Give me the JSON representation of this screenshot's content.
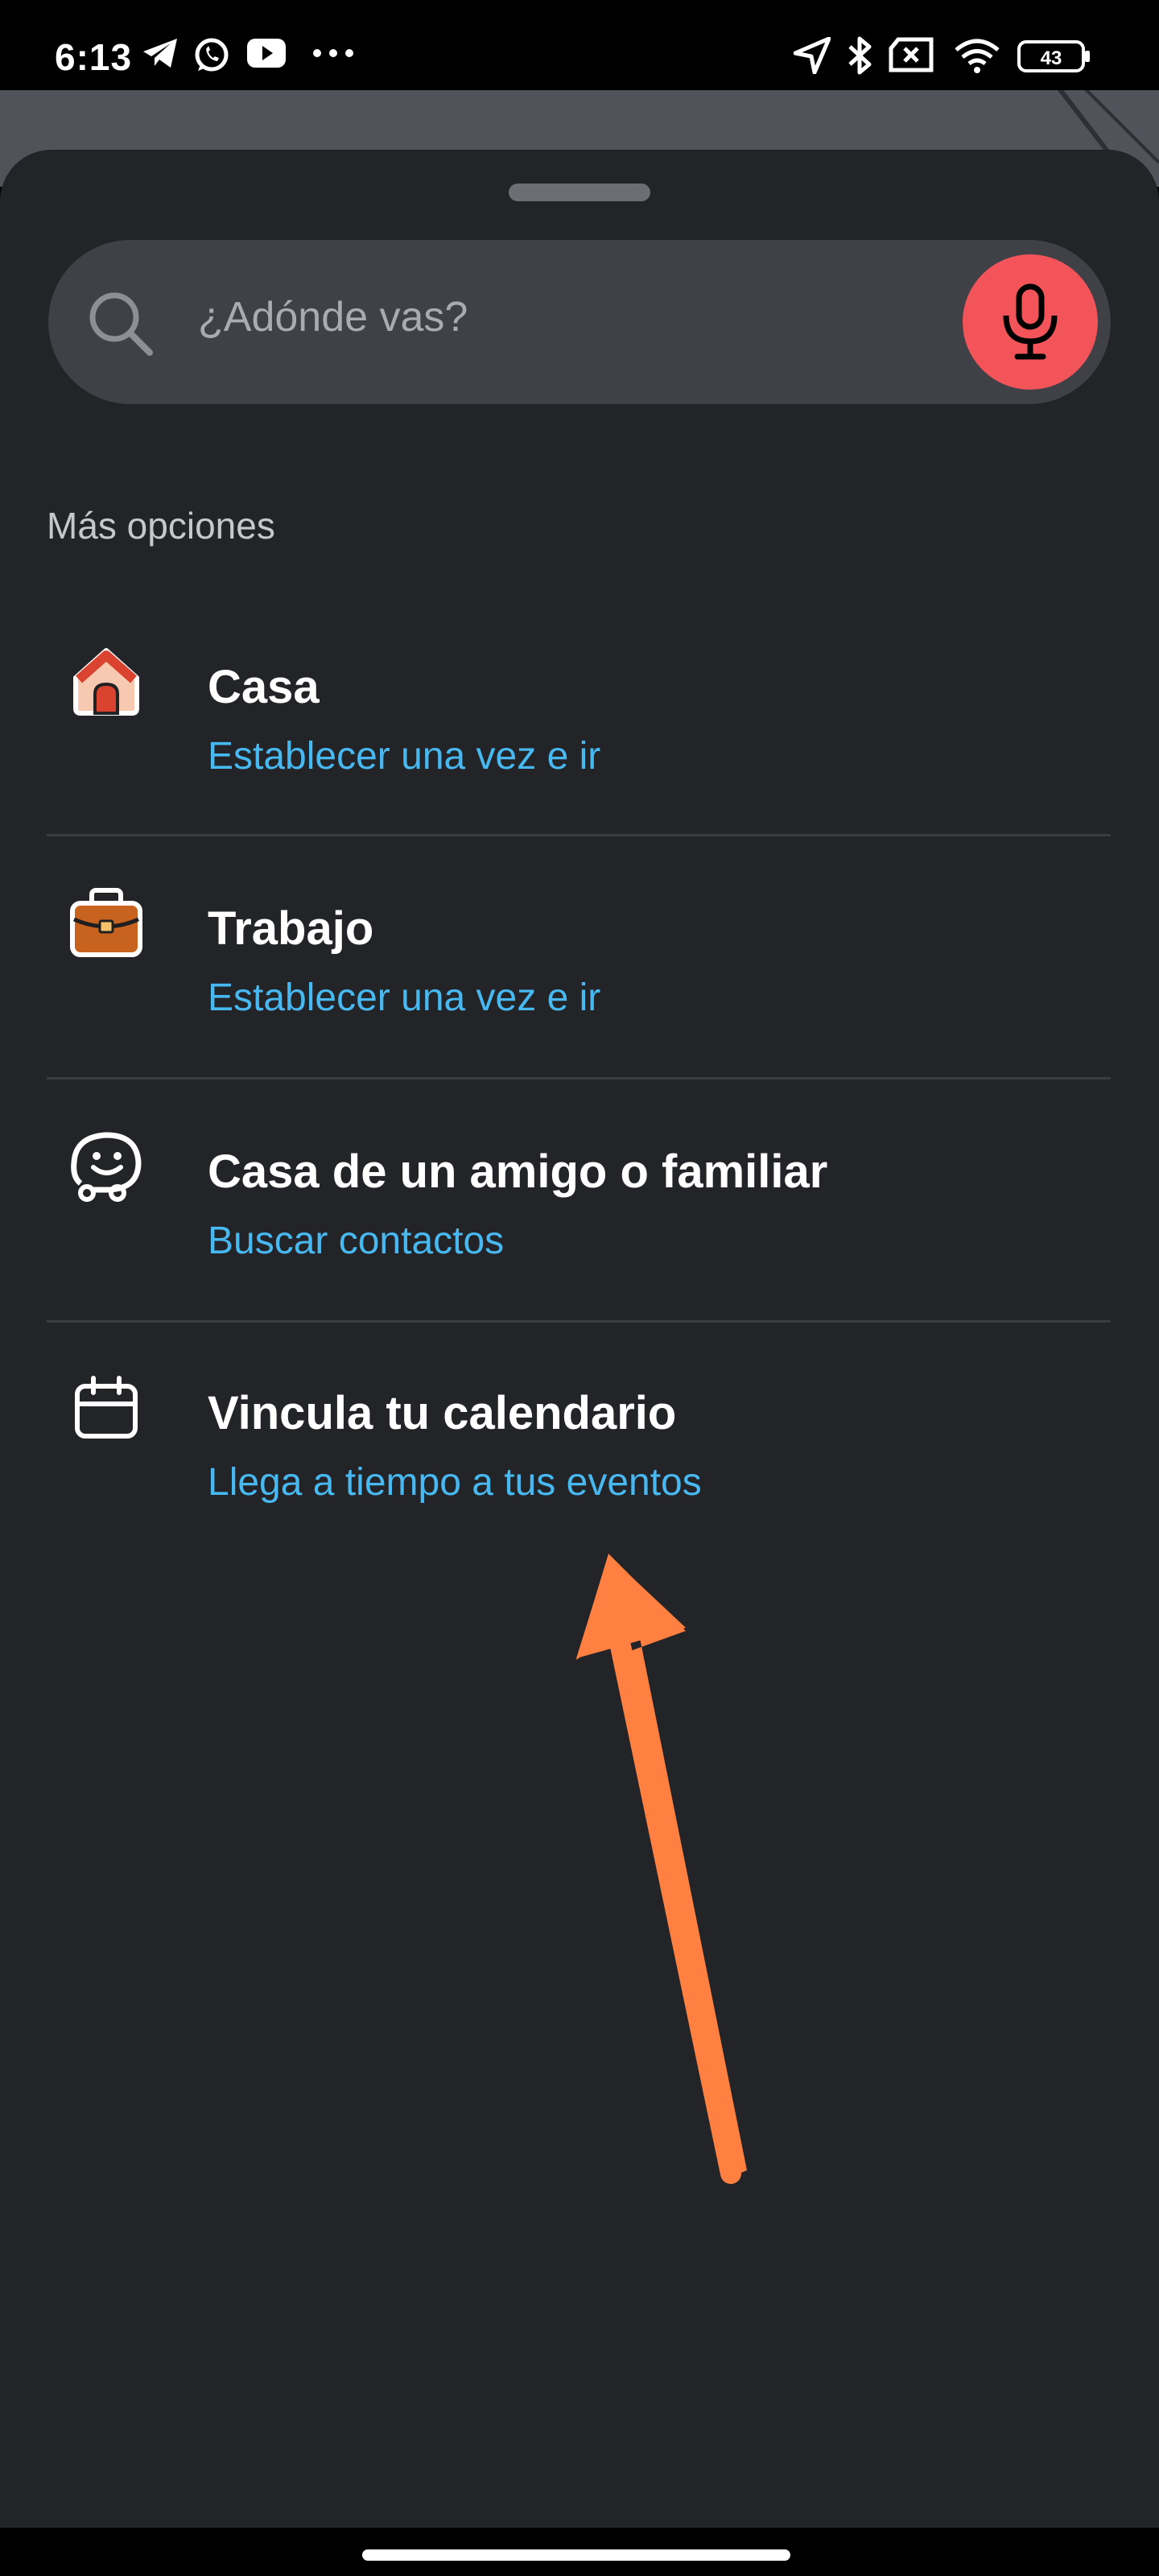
{
  "status_bar": {
    "time": "6:13",
    "left_icons": [
      "telegram-icon",
      "whatsapp-icon",
      "youtube-icon",
      "more-dots-icon"
    ],
    "right_icons": [
      "location-arrow-icon",
      "bluetooth-icon",
      "no-sim-icon",
      "wifi-icon",
      "battery-icon"
    ],
    "battery_level": "43"
  },
  "search": {
    "placeholder": "¿Adónde vas?",
    "mic_color": "#f2545a"
  },
  "section": {
    "title": "Más opciones"
  },
  "options": [
    {
      "icon": "home-icon",
      "title": "Casa",
      "subtitle": "Establecer una vez e ir"
    },
    {
      "icon": "briefcase-icon",
      "title": "Trabajo",
      "subtitle": "Establecer una vez e ir"
    },
    {
      "icon": "waze-friend-icon",
      "title": "Casa de un amigo o familiar",
      "subtitle": "Buscar contactos"
    },
    {
      "icon": "calendar-icon",
      "title": "Vincula tu calendario",
      "subtitle": "Llega a tiempo a tus eventos"
    }
  ],
  "colors": {
    "sheet_background": "#232428",
    "link_blue": "#48b8f0",
    "annotation_arrow": "#ff8040"
  }
}
